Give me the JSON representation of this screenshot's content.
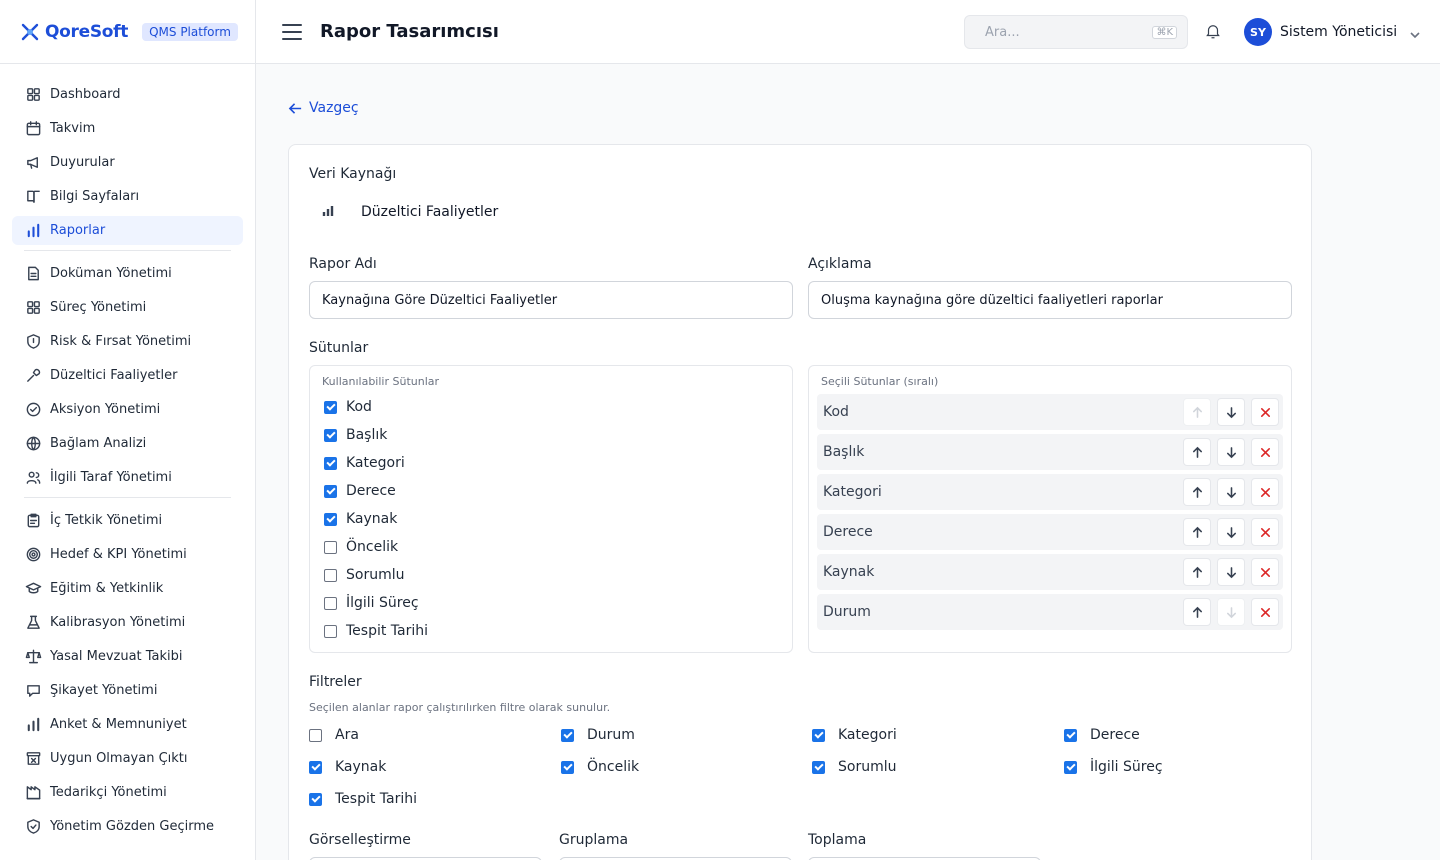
{
  "brand": {
    "name": "QoreSoft",
    "badge": "QMS Platform",
    "color": "#1d4ed8"
  },
  "topbar": {
    "title": "Rapor Tasarımcısı",
    "search_placeholder": "Ara...",
    "search_shortcut": "⌘K",
    "user_initials": "SY",
    "user_name": "Sistem Yöneticisi"
  },
  "sidebar": {
    "group1": [
      {
        "label": "Dashboard",
        "icon": "grid-icon"
      },
      {
        "label": "Takvim",
        "icon": "calendar-icon"
      },
      {
        "label": "Duyurular",
        "icon": "megaphone-icon"
      },
      {
        "label": "Bilgi Sayfaları",
        "icon": "book-icon"
      },
      {
        "label": "Raporlar",
        "icon": "bar-chart-icon",
        "active": true
      }
    ],
    "group2": [
      {
        "label": "Doküman Yönetimi",
        "icon": "document-icon"
      },
      {
        "label": "Süreç Yönetimi",
        "icon": "grid-icon"
      },
      {
        "label": "Risk & Fırsat Yönetimi",
        "icon": "shield-icon"
      },
      {
        "label": "Düzeltici Faaliyetler",
        "icon": "wrench-icon"
      },
      {
        "label": "Aksiyon Yönetimi",
        "icon": "check-circle-icon"
      },
      {
        "label": "Bağlam Analizi",
        "icon": "globe-icon"
      },
      {
        "label": "İlgili Taraf Yönetimi",
        "icon": "users-icon"
      }
    ],
    "group3": [
      {
        "label": "İç Tetkik Yönetimi",
        "icon": "clipboard-icon"
      },
      {
        "label": "Hedef & KPI Yönetimi",
        "icon": "target-icon"
      },
      {
        "label": "Eğitim & Yetkinlik",
        "icon": "graduation-cap-icon"
      },
      {
        "label": "Kalibrasyon Yönetimi",
        "icon": "flask-icon"
      },
      {
        "label": "Yasal Mevzuat Takibi",
        "icon": "scale-icon"
      },
      {
        "label": "Şikayet Yönetimi",
        "icon": "comment-icon"
      },
      {
        "label": "Anket & Memnuniyet",
        "icon": "bar-chart-icon"
      },
      {
        "label": "Uygun Olmayan Çıktı",
        "icon": "archive-x-icon"
      },
      {
        "label": "Tedarikçi Yönetimi",
        "icon": "factory-icon"
      },
      {
        "label": "Yönetim Gözden Geçirme",
        "icon": "shield-check-icon"
      }
    ]
  },
  "main": {
    "back_label": "Vazgeç",
    "data_source_label": "Veri Kaynağı",
    "data_source_value": "Düzeltici Faaliyetler",
    "report_name_label": "Rapor Adı",
    "report_name_value": "Kaynağına Göre Düzeltici Faaliyetler",
    "description_label": "Açıklama",
    "description_value": "Oluşma kaynağına göre düzeltici faaliyetleri raporlar",
    "columns_label": "Sütunlar",
    "available_columns_label": "Kullanılabilir Sütunlar",
    "selected_columns_label": "Seçili Sütunlar (sıralı)",
    "available_columns": [
      {
        "label": "Kod",
        "checked": true
      },
      {
        "label": "Başlık",
        "checked": true
      },
      {
        "label": "Kategori",
        "checked": true
      },
      {
        "label": "Derece",
        "checked": true
      },
      {
        "label": "Kaynak",
        "checked": true
      },
      {
        "label": "Öncelik",
        "checked": false
      },
      {
        "label": "Sorumlu",
        "checked": false
      },
      {
        "label": "İlgili Süreç",
        "checked": false
      },
      {
        "label": "Tespit Tarihi",
        "checked": false
      }
    ],
    "selected_columns": [
      "Kod",
      "Başlık",
      "Kategori",
      "Derece",
      "Kaynak",
      "Durum"
    ],
    "filters_label": "Filtreler",
    "filters_hint": "Seçilen alanlar rapor çalıştırılırken filtre olarak sunulur.",
    "filters": [
      {
        "label": "Ara",
        "checked": false
      },
      {
        "label": "Durum",
        "checked": true
      },
      {
        "label": "Kategori",
        "checked": true
      },
      {
        "label": "Derece",
        "checked": true
      },
      {
        "label": "Kaynak",
        "checked": true
      },
      {
        "label": "Öncelik",
        "checked": true
      },
      {
        "label": "Sorumlu",
        "checked": true
      },
      {
        "label": "İlgili Süreç",
        "checked": true
      },
      {
        "label": "Tespit Tarihi",
        "checked": true
      }
    ],
    "visualization_label": "Görselleştirme",
    "grouping_label": "Gruplama",
    "aggregation_label": "Toplama"
  },
  "colors": {
    "accent": "#1d4ed8",
    "checkbox": "#1a73e8",
    "danger": "#dc2626"
  }
}
